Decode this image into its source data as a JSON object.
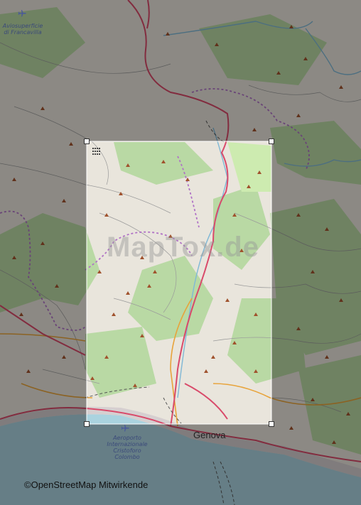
{
  "map": {
    "place_labels": {
      "airfield": "Aviosuperficie\ndi Francavilla",
      "airport": "Aeroporto\nInternazionale\nCristoforo\nColombo",
      "city": "Genova"
    },
    "watermark": "MapTox.de",
    "attribution": "©OpenStreetMap Mitwirkende"
  },
  "colors": {
    "land": "#e9e5dc",
    "forest": "#b9d9a4",
    "sea": "#aad3df",
    "road_primary": "#d94a6a",
    "road_secondary": "#e8a33a",
    "border": "#b072c6",
    "river": "#7fb8d6",
    "peak": "#a0522d",
    "mask": "#000000"
  }
}
